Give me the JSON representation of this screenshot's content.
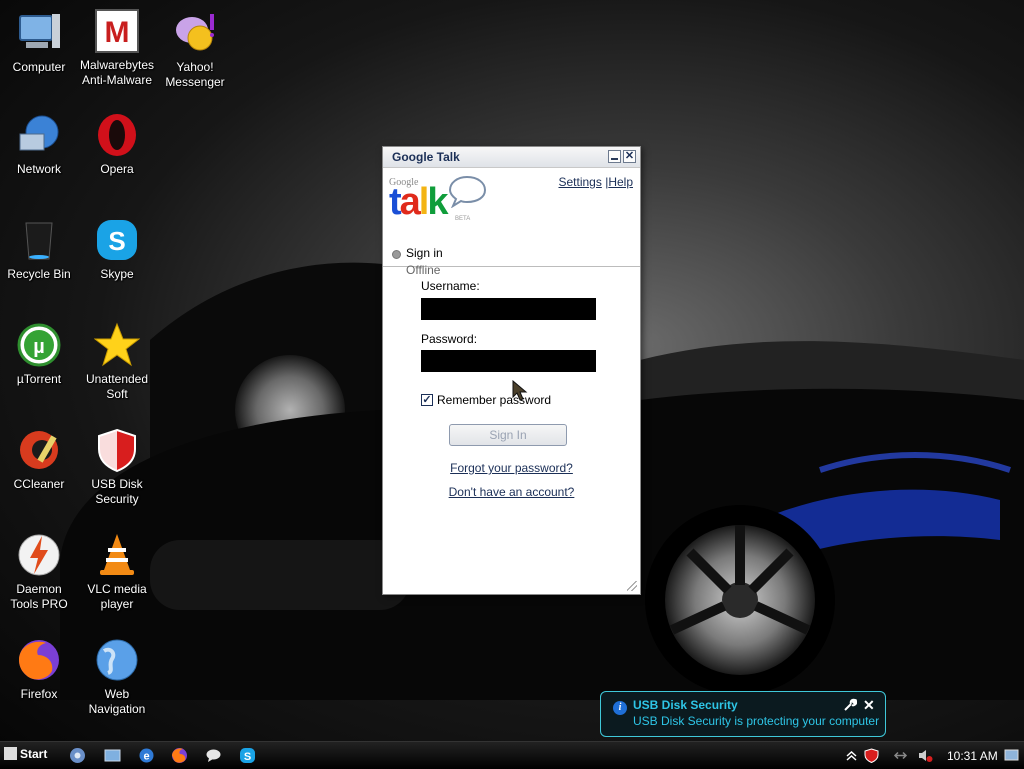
{
  "desktop": {
    "icons": [
      {
        "label_lines": [
          "Computer"
        ]
      },
      {
        "label_lines": [
          "Malwarebytes",
          "Anti-Malware"
        ]
      },
      {
        "label_lines": [
          "Yahoo!",
          "Messenger"
        ]
      },
      {
        "label_lines": [
          "Network"
        ]
      },
      {
        "label_lines": [
          "Opera"
        ]
      },
      {
        "label_lines": [
          "Recycle Bin"
        ]
      },
      {
        "label_lines": [
          "Skype"
        ]
      },
      {
        "label_lines": [
          "µTorrent"
        ]
      },
      {
        "label_lines": [
          "Unattended",
          "Soft"
        ]
      },
      {
        "label_lines": [
          "CCleaner"
        ]
      },
      {
        "label_lines": [
          "USB Disk",
          "Security"
        ]
      },
      {
        "label_lines": [
          "Daemon",
          "Tools PRO"
        ]
      },
      {
        "label_lines": [
          "VLC media",
          "player"
        ]
      },
      {
        "label_lines": [
          "Firefox"
        ]
      },
      {
        "label_lines": [
          "Web",
          "Navigation"
        ]
      }
    ]
  },
  "gtalk": {
    "title": "Google Talk",
    "logo_google": "Google",
    "logo_talk": "talk",
    "logo_beta": "BETA",
    "links": {
      "settings": "Settings",
      "separator": "|",
      "help": "Help"
    },
    "status_label": "Sign in",
    "status_value": "Offline",
    "username_label": "Username:",
    "username_value": "",
    "password_label": "Password:",
    "password_value": "",
    "remember_label": "Remember password",
    "remember_checked": true,
    "signin_button": "Sign In",
    "forgot_link": "Forgot your password?",
    "account_link": "Don't have an account?",
    "colors": {
      "t": "#1a4fd6",
      "a": "#e02a1b",
      "l": "#f3b414",
      "k": "#0f9d3a"
    }
  },
  "balloon": {
    "title": "USB Disk Security",
    "text": "USB Disk Security is protecting your computer",
    "info_glyph": "i",
    "close_glyph": "✕"
  },
  "taskbar": {
    "start_label": "Start",
    "clock": "10:31 AM"
  }
}
